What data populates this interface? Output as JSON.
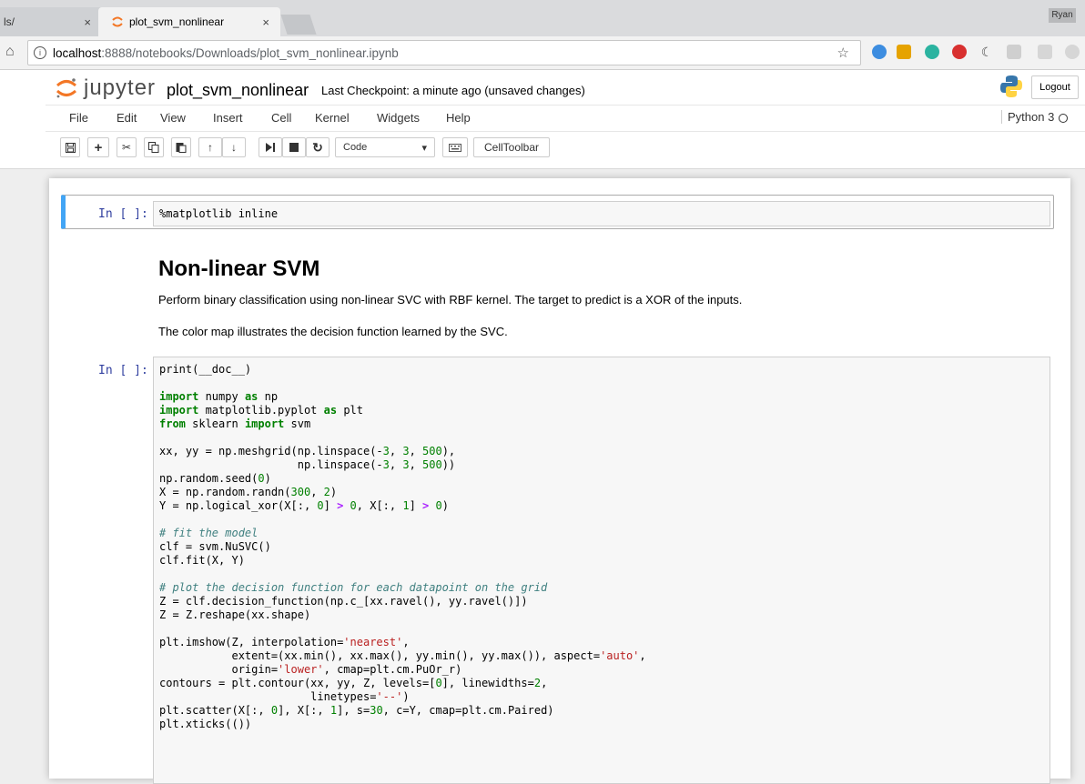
{
  "browser": {
    "prev_tab_title": "ls/",
    "active_tab_title": "plot_svm_nonlinear",
    "tab_close": "×",
    "profile_name": "Ryan",
    "url_host": "localhost",
    "url_path": ":8888/notebooks/Downloads/plot_svm_nonlinear.ipynb",
    "info_glyph": "i",
    "star_glyph": "☆",
    "home_glyph": "⌂"
  },
  "jupyter": {
    "logo_text": "jupyter",
    "notebook_name": "plot_svm_nonlinear",
    "checkpoint": "Last Checkpoint: a minute ago (unsaved changes)",
    "logout_label": "Logout",
    "kernel_name": "Python 3",
    "menu": [
      "File",
      "Edit",
      "View",
      "Insert",
      "Cell",
      "Kernel",
      "Widgets",
      "Help"
    ],
    "cell_type": "Code",
    "celltoolbar_label": "CellToolbar"
  },
  "cells": {
    "cell1_prompt": "In [ ]:",
    "cell1_code": "%matplotlib inline",
    "md_heading": "Non-linear SVM",
    "md_para1": "Perform binary classification using non-linear SVC with RBF kernel. The target to predict is a XOR of the inputs.",
    "md_para2": "The color map illustrates the decision function learned by the SVC.",
    "cell2_prompt": "In [ ]:",
    "cell2_code": "print(__doc__)\n\nimport numpy as np\nimport matplotlib.pyplot as plt\nfrom sklearn import svm\n\nxx, yy = np.meshgrid(np.linspace(-3, 3, 500),\n                     np.linspace(-3, 3, 500))\nnp.random.seed(0)\nX = np.random.randn(300, 2)\nY = np.logical_xor(X[:, 0] > 0, X[:, 1] > 0)\n\n# fit the model\nclf = svm.NuSVC()\nclf.fit(X, Y)\n\n# plot the decision function for each datapoint on the grid\nZ = clf.decision_function(np.c_[xx.ravel(), yy.ravel()])\nZ = Z.reshape(xx.shape)\n\nplt.imshow(Z, interpolation='nearest',\n           extent=(xx.min(), xx.max(), yy.min(), yy.max()), aspect='auto',\n           origin='lower', cmap=plt.cm.PuOr_r)\ncontours = plt.contour(xx, yy, Z, levels=[0], linewidths=2,\n                       linetypes='--')\nplt.scatter(X[:, 0], X[:, 1], s=30, c=Y, cmap=plt.cm.Paired)\nplt.xticks(())"
  },
  "colors": {
    "accent_cell": "#42a5f5",
    "prompt": "#303f9f",
    "keyword": "#008000",
    "string": "#ba2121",
    "comment": "#408080"
  }
}
